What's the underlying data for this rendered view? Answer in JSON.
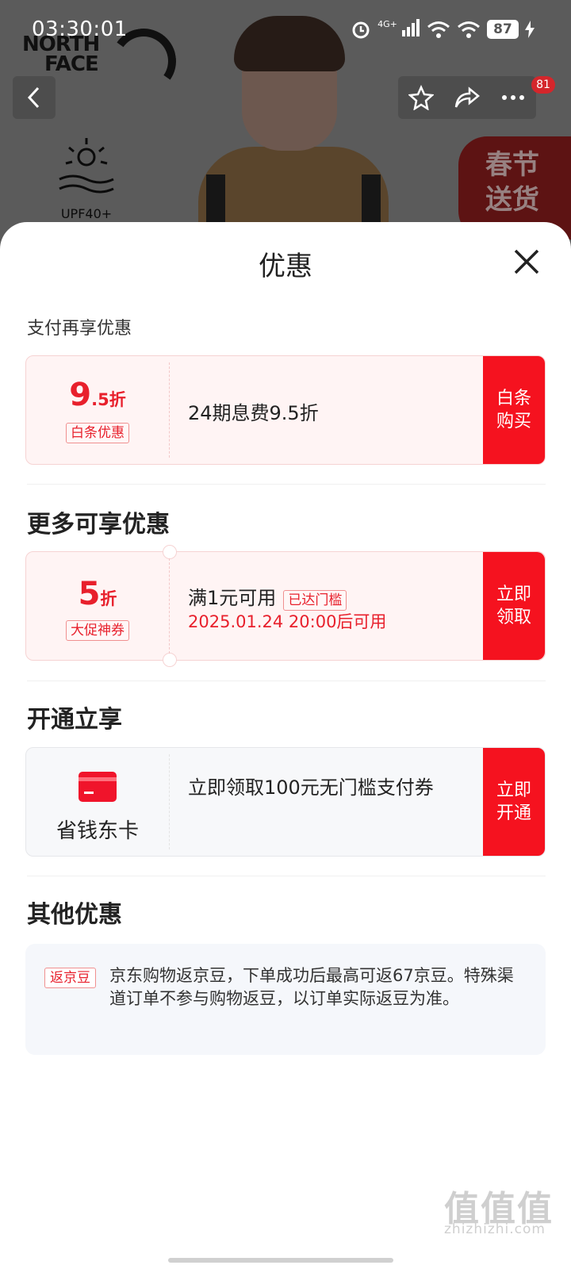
{
  "status_bar": {
    "time": "03:30:01",
    "network": "4G+",
    "battery": "87"
  },
  "background": {
    "brand_logo_line1": "NORTH",
    "brand_logo_line2": "FACE",
    "upf_label": "UPF40+",
    "spring_badge": "春节送货",
    "notification_count": "81"
  },
  "sheet": {
    "title": "优惠",
    "payment_section": {
      "label": "支付再享优惠",
      "coupon": {
        "discount_int": "9",
        "discount_unit": ".5折",
        "tag": "白条优惠",
        "description": "24期息费9.5折",
        "action": "白条购买"
      }
    },
    "more_section": {
      "label": "更多可享优惠",
      "coupon": {
        "discount_int": "5",
        "discount_unit": "折",
        "tag": "大促神券",
        "condition": "满1元可用",
        "condition_tag": "已达门槛",
        "valid_time": "2025.01.24 20:00后可用",
        "action": "立即领取"
      }
    },
    "open_section": {
      "label": "开通立享",
      "card": {
        "name": "省钱东卡",
        "description": "立即领取100元无门槛支付券",
        "action": "立即开通"
      }
    },
    "other_section": {
      "label": "其他优惠",
      "info": {
        "tag": "返京豆",
        "text": "京东购物返京豆，下单成功后最高可返67京豆。特殊渠道订单不参与购物返豆，以订单实际返豆为准。"
      }
    }
  },
  "watermark": {
    "main": "值值值",
    "sub": "zhizhizhi.com"
  },
  "colors": {
    "accent_red": "#f5121f",
    "coupon_bg": "#fff4f4",
    "info_bg": "#f5f7fb"
  },
  "icons": [
    "alarm-icon",
    "signal-icon",
    "wifi-icon",
    "battery-icon",
    "charging-icon",
    "back-icon",
    "star-icon",
    "share-icon",
    "more-icon",
    "close-icon",
    "card-icon",
    "sun-icon"
  ]
}
